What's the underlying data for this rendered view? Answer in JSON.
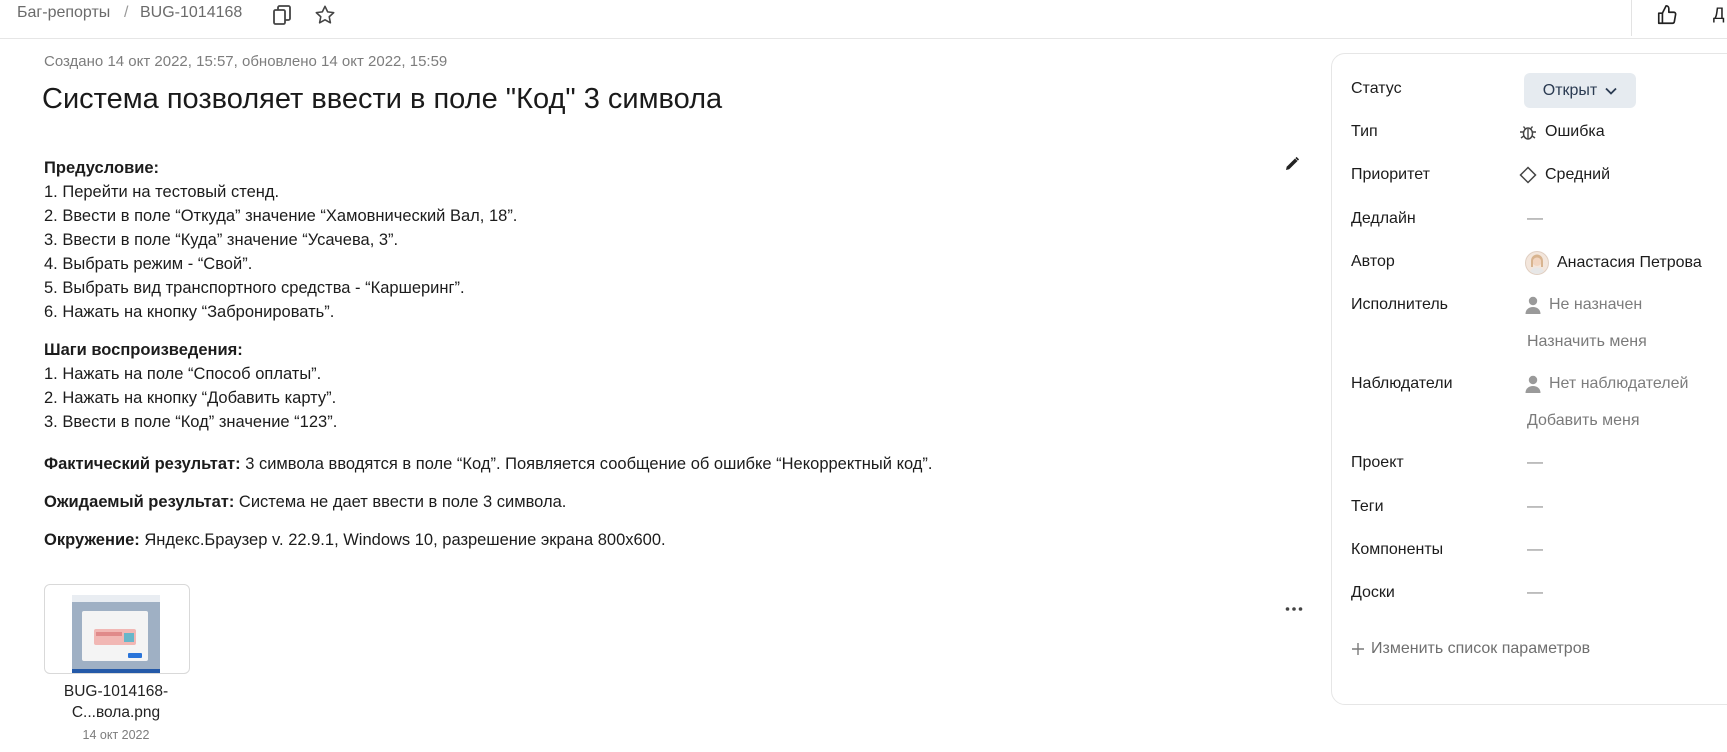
{
  "breadcrumb": {
    "queue": "Баг-репорты",
    "separator": "/",
    "issue_key": "BUG-1014168"
  },
  "header_right": {
    "cut_label": "Д"
  },
  "issue": {
    "meta": "Создано 14 окт 2022, 15:57, обновлено 14 окт 2022, 15:59",
    "title": "Система позволяет ввести в поле \"Код\" 3 символа",
    "precondition": {
      "heading": "Предусловие:",
      "lines": [
        "1. Перейти на тестовый стенд.",
        "2. Ввести в поле “Откуда” значение “Хамовнический Вал, 18”.",
        "3. Ввести в поле “Куда” значение “Усачева, 3”.",
        "4. Выбрать режим - “Свой”.",
        "5. Выбрать вид транспортного средства - “Каршеринг”.",
        "6. Нажать на кнопку “Забронировать”."
      ]
    },
    "steps": {
      "heading": "Шаги воспроизведения:",
      "lines": [
        "1. Нажать на поле “Способ оплаты”.",
        "2. Нажать на кнопку “Добавить карту”.",
        "3. Ввести в поле “Код” значение “123”."
      ]
    },
    "actual": {
      "label": "Фактический результат:",
      "text": " 3 символа вводятся в поле “Код”. Появляется сообщение об ошибке “Некорректный код”."
    },
    "expected": {
      "label": "Ожидаемый результат:",
      "text": " Система не дает ввести в поле 3 символа."
    },
    "environment": {
      "label": "Окружение:",
      "text": " Яндекс.Браузер v. 22.9.1, Windows 10, разрешение экрана 800х600."
    }
  },
  "attachment": {
    "name": "BUG-1014168-С...вола.png",
    "date": "14 окт 2022"
  },
  "sidebar": {
    "status": {
      "label": "Статус",
      "value": "Открыт"
    },
    "type": {
      "label": "Тип",
      "value": "Ошибка"
    },
    "priority": {
      "label": "Приоритет",
      "value": "Средний"
    },
    "deadline": {
      "label": "Дедлайн",
      "value": "—"
    },
    "author": {
      "label": "Автор",
      "value": "Анастасия Петрова"
    },
    "assignee": {
      "label": "Исполнитель",
      "value": "Не назначен",
      "action": "Назначить меня"
    },
    "followers": {
      "label": "Наблюдатели",
      "value": "Нет наблюдателей",
      "action": "Добавить меня"
    },
    "project": {
      "label": "Проект",
      "value": "—"
    },
    "tags": {
      "label": "Теги",
      "value": "—"
    },
    "components": {
      "label": "Компоненты",
      "value": "—"
    },
    "boards": {
      "label": "Доски",
      "value": "—"
    },
    "change_params": "Изменить список параметров"
  },
  "icons": {
    "copy": "copy-icon",
    "star": "star-icon",
    "like": "thumbs-up-icon",
    "edit": "pencil-icon",
    "more": "more-icon",
    "bug": "bug-icon",
    "priority": "diamond-icon",
    "person": "person-icon",
    "plus": "plus-icon",
    "chevron": "chevron-down-icon"
  }
}
